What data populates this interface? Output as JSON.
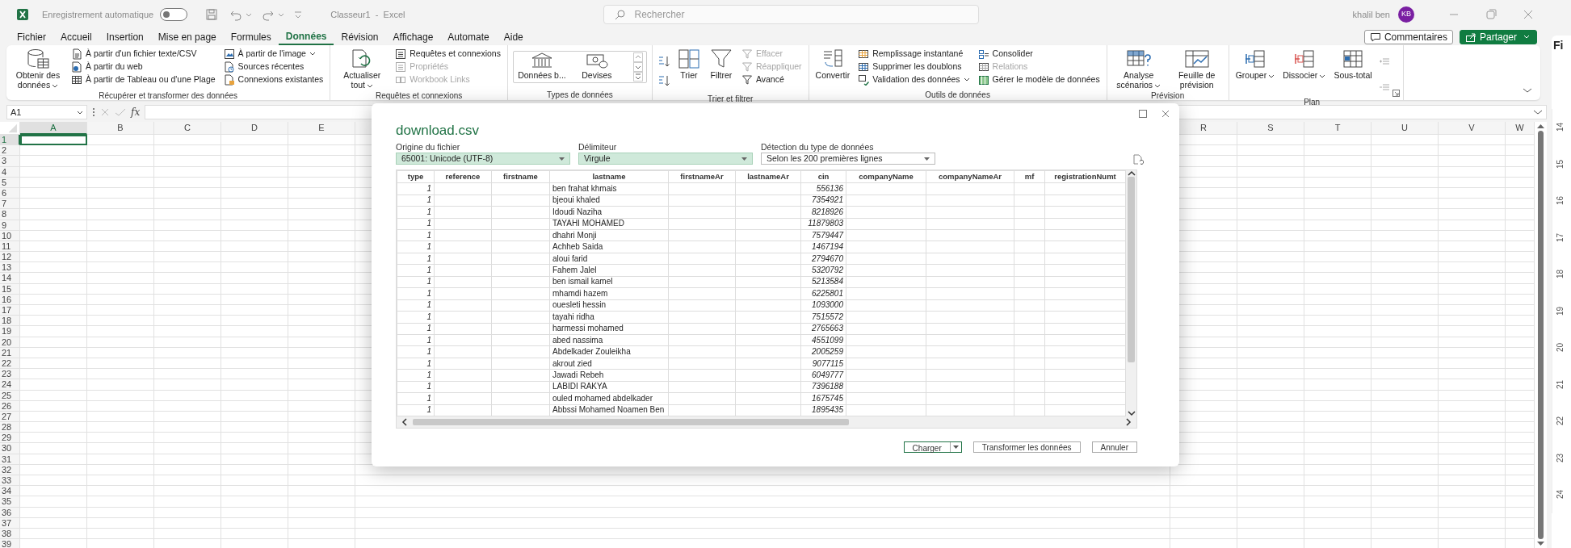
{
  "title_bar": {
    "autosave_label": "Enregistrement automatique",
    "autosave_on": false,
    "document_title": "Classeur1  -  Excel",
    "search": {
      "placeholder": "Rechercher"
    },
    "user_name": "khalil ben",
    "user_initials": "KB"
  },
  "menu_tabs": [
    {
      "label": "Fichier",
      "selected": false
    },
    {
      "label": "Accueil",
      "selected": false
    },
    {
      "label": "Insertion",
      "selected": false
    },
    {
      "label": "Mise en page",
      "selected": false
    },
    {
      "label": "Formules",
      "selected": false
    },
    {
      "label": "Données",
      "selected": true
    },
    {
      "label": "Révision",
      "selected": false
    },
    {
      "label": "Affichage",
      "selected": false
    },
    {
      "label": "Automate",
      "selected": false
    },
    {
      "label": "Aide",
      "selected": false
    }
  ],
  "header_buttons": [
    {
      "label": "Commentaires",
      "kind": "outline"
    },
    {
      "label": "Partager",
      "kind": "primary"
    }
  ],
  "ribbon": {
    "groups": [
      {
        "label": "Récupérer et transformer des données",
        "launcher": false,
        "items": [
          {
            "kind": "large",
            "label": "Obtenir des données",
            "dropdown": true
          },
          {
            "kind": "stack",
            "entries": [
              {
                "label": "À partir d'un fichier texte/CSV",
                "disabled": false,
                "dropdown": false
              },
              {
                "label": "À partir du web",
                "disabled": false,
                "dropdown": false
              },
              {
                "label": "À partir de Tableau ou d'une Plage",
                "disabled": false,
                "dropdown": false
              }
            ]
          },
          {
            "kind": "stack",
            "entries": [
              {
                "label": "À partir de l'image",
                "disabled": false,
                "dropdown": true
              },
              {
                "label": "Sources récentes",
                "disabled": false,
                "dropdown": false
              },
              {
                "label": "Connexions existantes",
                "disabled": false,
                "dropdown": false
              }
            ]
          }
        ]
      },
      {
        "label": "Requêtes et connexions",
        "launcher": false,
        "items": [
          {
            "kind": "large",
            "label": "Actualiser tout",
            "dropdown": true
          },
          {
            "kind": "stack",
            "entries": [
              {
                "label": "Requêtes et connexions",
                "disabled": false,
                "dropdown": false
              },
              {
                "label": "Propriétés",
                "disabled": true,
                "dropdown": false
              },
              {
                "label": "Workbook Links",
                "disabled": true,
                "dropdown": false
              }
            ]
          }
        ]
      },
      {
        "label": "Types de données",
        "launcher": false,
        "items": [
          {
            "kind": "gallery",
            "entries": [
              {
                "label": "Données b..."
              },
              {
                "label": "Devises"
              }
            ]
          }
        ]
      },
      {
        "label": "Trier et filtrer",
        "launcher": false,
        "items": [
          {
            "kind": "sort"
          },
          {
            "kind": "large",
            "label": "Trier",
            "dropdown": false
          },
          {
            "kind": "large",
            "label": "Filtrer",
            "dropdown": false
          },
          {
            "kind": "stack",
            "entries": [
              {
                "label": "Effacer",
                "disabled": true,
                "dropdown": false
              },
              {
                "label": "Réappliquer",
                "disabled": true,
                "dropdown": false
              },
              {
                "label": "Avancé",
                "disabled": false,
                "dropdown": false
              }
            ]
          }
        ]
      },
      {
        "label": "Outils de données",
        "launcher": false,
        "items": [
          {
            "kind": "large",
            "label": "Convertir",
            "dropdown": false
          },
          {
            "kind": "stack",
            "entries": [
              {
                "label": "Remplissage instantané",
                "disabled": false,
                "dropdown": false
              },
              {
                "label": "Supprimer les doublons",
                "disabled": false,
                "dropdown": false
              },
              {
                "label": "Validation des données",
                "disabled": false,
                "dropdown": true
              }
            ]
          },
          {
            "kind": "stack",
            "entries": [
              {
                "label": "Consolider",
                "disabled": false,
                "dropdown": false
              },
              {
                "label": "Relations",
                "disabled": true,
                "dropdown": false
              },
              {
                "label": "Gérer le modèle de données",
                "disabled": false,
                "dropdown": false
              }
            ]
          }
        ]
      },
      {
        "label": "Prévision",
        "launcher": false,
        "items": [
          {
            "kind": "large",
            "label": "Analyse scénarios",
            "dropdown": true
          },
          {
            "kind": "large",
            "label": "Feuille de prévision",
            "dropdown": false
          }
        ]
      },
      {
        "label": "Plan",
        "launcher": true,
        "items": [
          {
            "kind": "large",
            "label": "Grouper",
            "dropdown": true
          },
          {
            "kind": "large",
            "label": "Dissocier",
            "dropdown": true
          },
          {
            "kind": "large",
            "label": "Sous-total",
            "dropdown": false
          },
          {
            "kind": "detail"
          }
        ]
      }
    ]
  },
  "formula_bar": {
    "name_box": "A1",
    "function_label": "fx"
  },
  "grid": {
    "columns_left": [
      {
        "label": "A",
        "selected": true
      },
      {
        "label": "B",
        "selected": false
      },
      {
        "label": "C",
        "selected": false
      },
      {
        "label": "D",
        "selected": false
      },
      {
        "label": "E",
        "selected": false
      }
    ],
    "columns_right": [
      {
        "label": "R",
        "selected": false
      },
      {
        "label": "S",
        "selected": false
      },
      {
        "label": "T",
        "selected": false
      },
      {
        "label": "U",
        "selected": false
      },
      {
        "label": "V",
        "selected": false
      },
      {
        "label": "W",
        "selected": false
      }
    ],
    "rows": [
      {
        "label": "1",
        "selected": true
      },
      {
        "label": "2",
        "selected": false
      },
      {
        "label": "3",
        "selected": false
      },
      {
        "label": "4",
        "selected": false
      },
      {
        "label": "5",
        "selected": false
      },
      {
        "label": "6",
        "selected": false
      },
      {
        "label": "7",
        "selected": false
      },
      {
        "label": "8",
        "selected": false
      },
      {
        "label": "9",
        "selected": false
      },
      {
        "label": "10",
        "selected": false
      },
      {
        "label": "11",
        "selected": false
      },
      {
        "label": "12",
        "selected": false
      },
      {
        "label": "13",
        "selected": false
      },
      {
        "label": "14",
        "selected": false
      },
      {
        "label": "15",
        "selected": false
      },
      {
        "label": "16",
        "selected": false
      },
      {
        "label": "17",
        "selected": false
      },
      {
        "label": "18",
        "selected": false
      },
      {
        "label": "19",
        "selected": false
      },
      {
        "label": "20",
        "selected": false
      },
      {
        "label": "21",
        "selected": false
      },
      {
        "label": "22",
        "selected": false
      },
      {
        "label": "23",
        "selected": false
      },
      {
        "label": "24",
        "selected": false
      },
      {
        "label": "25",
        "selected": false
      },
      {
        "label": "26",
        "selected": false
      },
      {
        "label": "27",
        "selected": false
      },
      {
        "label": "28",
        "selected": false
      },
      {
        "label": "29",
        "selected": false
      },
      {
        "label": "30",
        "selected": false
      },
      {
        "label": "31",
        "selected": false
      },
      {
        "label": "32",
        "selected": false
      },
      {
        "label": "33",
        "selected": false
      },
      {
        "label": "34",
        "selected": false
      },
      {
        "label": "35",
        "selected": false
      },
      {
        "label": "36",
        "selected": false
      },
      {
        "label": "37",
        "selected": false
      },
      {
        "label": "38",
        "selected": false
      },
      {
        "label": "39",
        "selected": false
      }
    ]
  },
  "dialog": {
    "title": "download.csv",
    "fields": [
      {
        "label": "Origine du fichier",
        "value": "65001: Unicode (UTF-8)",
        "highlighted": true
      },
      {
        "label": "Délimiteur",
        "value": "Virgule",
        "highlighted": true
      },
      {
        "label": "Détection du type de données",
        "value": "Selon les 200 premières lignes",
        "highlighted": false
      }
    ],
    "table": {
      "columns": [
        "type",
        "reference",
        "firstname",
        "lastname",
        "firstnameAr",
        "lastnameAr",
        "cin",
        "companyName",
        "companyNameAr",
        "mf",
        "registrationNumt"
      ],
      "rows": [
        {
          "type": "1",
          "lastname": "ben frahat khmais",
          "cin": "556136"
        },
        {
          "type": "1",
          "lastname": "bjeoui khaled",
          "cin": "7354921"
        },
        {
          "type": "1",
          "lastname": "Idoudi Naziha",
          "cin": "8218926"
        },
        {
          "type": "1",
          "lastname": "TAYAHI MOHAMED",
          "cin": "11879803"
        },
        {
          "type": "1",
          "lastname": "dhahri Monji",
          "cin": "7579447"
        },
        {
          "type": "1",
          "lastname": "Achheb Saida",
          "cin": "1467194"
        },
        {
          "type": "1",
          "lastname": "aloui farid",
          "cin": "2794670"
        },
        {
          "type": "1",
          "lastname": "Fahem Jalel",
          "cin": "5320792"
        },
        {
          "type": "1",
          "lastname": "ben ismail kamel",
          "cin": "5213584"
        },
        {
          "type": "1",
          "lastname": "mhamdi hazem",
          "cin": "6225801"
        },
        {
          "type": "1",
          "lastname": "ouesleti hessin",
          "cin": "1093000"
        },
        {
          "type": "1",
          "lastname": "tayahi ridha",
          "cin": "7515572"
        },
        {
          "type": "1",
          "lastname": "harmessi mohamed",
          "cin": "2765663"
        },
        {
          "type": "1",
          "lastname": "abed nassima",
          "cin": "4551099"
        },
        {
          "type": "1",
          "lastname": "Abdelkader Zouleikha",
          "cin": "2005259"
        },
        {
          "type": "1",
          "lastname": "akrout zied",
          "cin": "9077115"
        },
        {
          "type": "1",
          "lastname": "Jawadi Rebeh",
          "cin": "6049777"
        },
        {
          "type": "1",
          "lastname": "LABIDI RAKYA",
          "cin": "7396188"
        },
        {
          "type": "1",
          "lastname": "ouled mohamed abdelkader",
          "cin": "1675745"
        },
        {
          "type": "1",
          "lastname": "Abbssi Mohamed Noamen Ben",
          "cin": "1895435"
        }
      ]
    },
    "buttons": [
      {
        "label": "Charger",
        "kind": "split",
        "primary": true
      },
      {
        "label": "Transformer les données",
        "kind": "plain",
        "primary": false
      },
      {
        "label": "Annuler",
        "kind": "plain",
        "primary": false
      }
    ]
  },
  "side_panel": {
    "title_fragment": "Fi",
    "ruler": [
      "14",
      "15",
      "16",
      "17",
      "18",
      "19",
      "20",
      "21",
      "22",
      "23",
      "24"
    ]
  }
}
